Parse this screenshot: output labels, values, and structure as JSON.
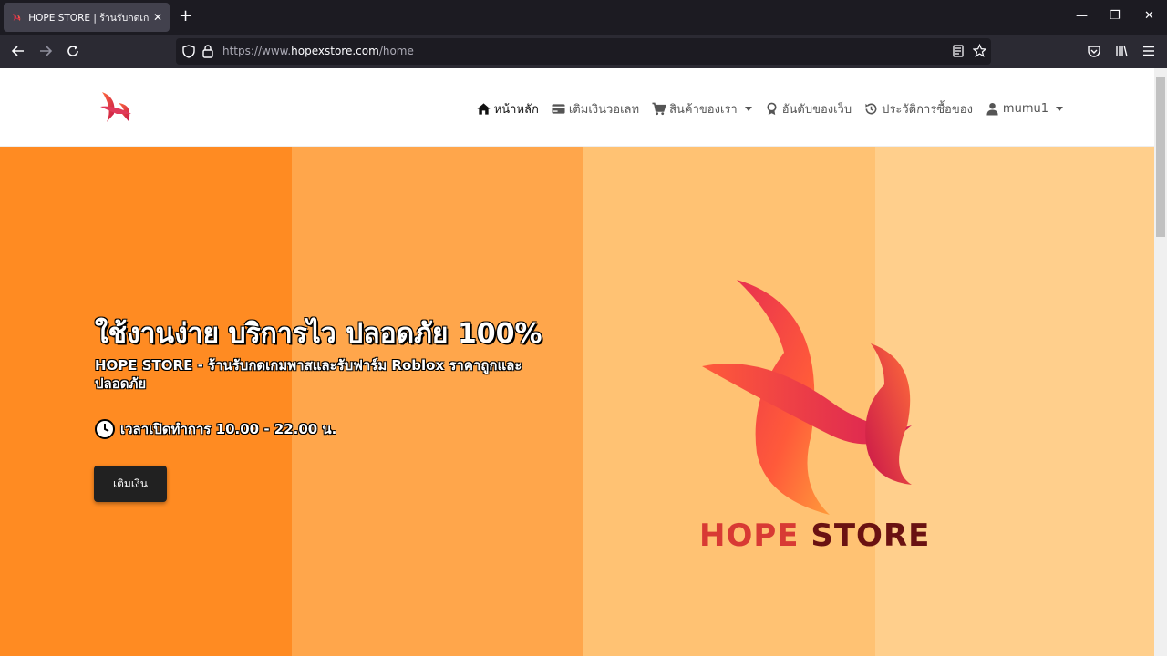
{
  "browser": {
    "tab_title": "HOPE STORE | ร้านรับกดเกมพาส",
    "tab_close": "✕",
    "new_tab": "+",
    "url_prefix": "https://www.",
    "url_host": "hopexstore.com",
    "url_path": "/home",
    "controls": {
      "minimize": "—",
      "restore": "❐",
      "close": "✕"
    }
  },
  "site": {
    "menu": [
      {
        "label": "หน้าหลัก",
        "icon": "home-icon"
      },
      {
        "label": "เติมเงินวอเลท",
        "icon": "credit-card-icon"
      },
      {
        "label": "สินค้าของเรา",
        "icon": "cart-icon"
      },
      {
        "label": "อันดับของเว็บ",
        "icon": "award-icon"
      },
      {
        "label": "ประวัติการซื้อของ",
        "icon": "history-icon"
      },
      {
        "label": "mumu1",
        "icon": "user-icon"
      }
    ],
    "hero": {
      "title": "ใช้งานง่าย บริการไว ปลอดภัย 100%",
      "subtitle": "HOPE STORE - ร้านรับกดเกมพาสและรับฟาร์ม Roblox ราคาถูกและปลอดภัย",
      "hours": "เวลาเปิดทำการ 10.00 - 22.00 น.",
      "button": "เติมเงิน"
    },
    "brand": {
      "hope": "HOPE",
      "store": "STORE"
    }
  },
  "colors": {
    "stripe1": "#ff8b22",
    "stripe2": "#ffa64b",
    "stripe3": "#ffc273",
    "stripe4": "#ffcf8c",
    "brand_red": "#d83a34",
    "brand_dark": "#6a1212"
  }
}
